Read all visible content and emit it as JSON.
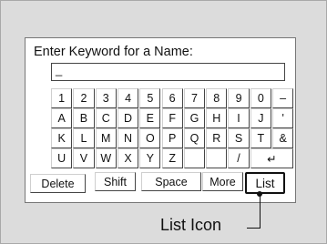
{
  "screen": {
    "title": "Enter Keyword for a Name:",
    "input": {
      "value": "_"
    }
  },
  "keyboard": {
    "rows": [
      [
        "1",
        "2",
        "3",
        "4",
        "5",
        "6",
        "7",
        "8",
        "9",
        "0",
        "–"
      ],
      [
        "A",
        "B",
        "C",
        "D",
        "E",
        "F",
        "G",
        "H",
        "I",
        "J",
        "'"
      ],
      [
        "K",
        "L",
        "M",
        "N",
        "O",
        "P",
        "Q",
        "R",
        "S",
        "T",
        "&"
      ],
      [
        "U",
        "V",
        "W",
        "X",
        "Y",
        "Z",
        "",
        "",
        "/",
        "↵"
      ]
    ],
    "functions": {
      "delete": "Delete",
      "shift": "Shift",
      "space": "Space",
      "more": "More",
      "list": "List"
    }
  },
  "callout": {
    "label": "List Icon"
  }
}
